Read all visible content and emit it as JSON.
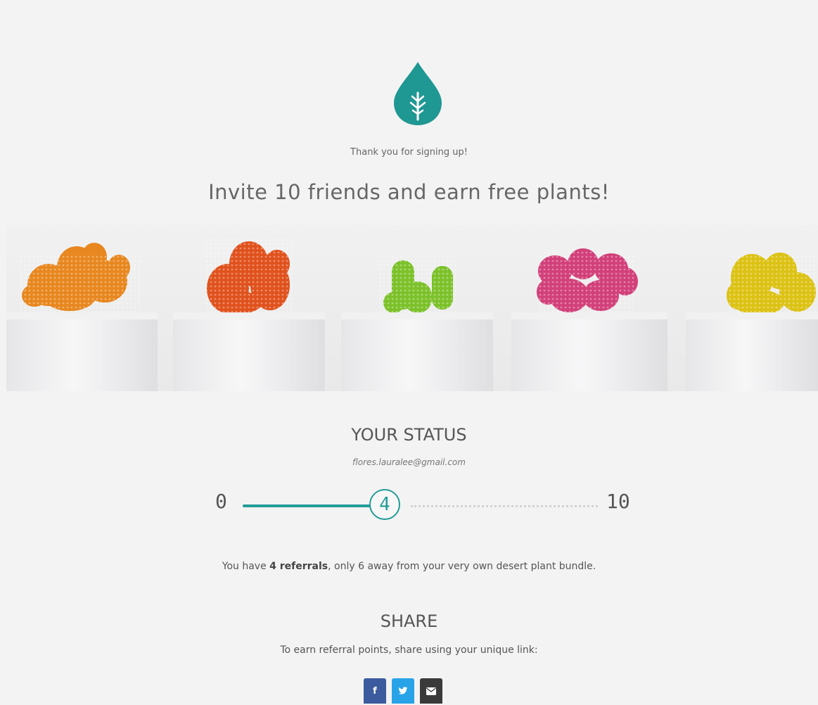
{
  "brand": {
    "logo_icon": "leaf-drop-icon",
    "accent_color": "#1f9793"
  },
  "header": {
    "thanks_text": "Thank you for signing up!",
    "headline": "Invite 10 friends and earn free plants!"
  },
  "banner": {
    "icon": "cactus-row-image",
    "cactus_colors": [
      "#e8871f",
      "#e0521d",
      "#7cc12a",
      "#d2407a",
      "#dcc214"
    ]
  },
  "status": {
    "title": "YOUR STATUS",
    "email": "flores.lauralee@gmail.com",
    "progress": {
      "min_label": "0",
      "max_label": "10",
      "current_label": "4",
      "value": 4,
      "max": 10
    }
  },
  "referral": {
    "prefix": "You have",
    "count_bold": "4 referrals",
    "suffix": ", only 6 away from your very own desert plant bundle."
  },
  "share": {
    "title": "SHARE",
    "text": "To earn referral points, share using your unique link:",
    "buttons": [
      {
        "network": "facebook",
        "glyph": "f",
        "icon": "facebook-icon",
        "color": "#3b5b9e"
      },
      {
        "network": "twitter",
        "glyph": "✔",
        "icon": "twitter-icon",
        "color": "#29a3e8"
      },
      {
        "network": "email",
        "glyph": "✉",
        "icon": "email-icon",
        "color": "#3a3a3a"
      }
    ]
  }
}
